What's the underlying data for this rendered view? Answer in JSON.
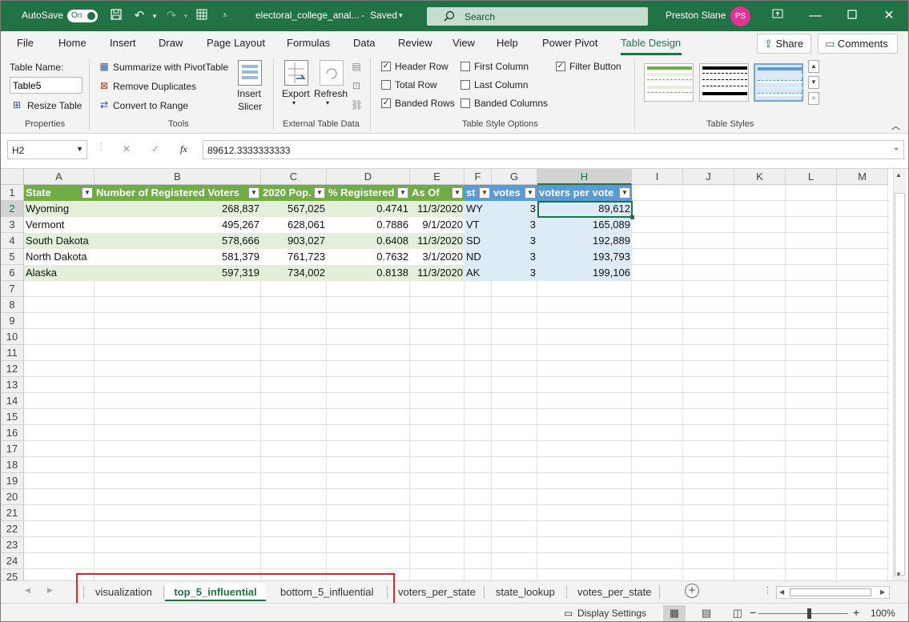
{
  "titlebar": {
    "autosave_label": "AutoSave",
    "autosave_state": "On",
    "filename": "electoral_college_anal...",
    "save_status": "Saved",
    "search_placeholder": "Search",
    "user_name": "Preston Slane",
    "user_initials": "PS"
  },
  "menu": {
    "items": [
      "File",
      "Home",
      "Insert",
      "Draw",
      "Page Layout",
      "Formulas",
      "Data",
      "Review",
      "View",
      "Help",
      "Power Pivot",
      "Table Design"
    ],
    "active": "Table Design",
    "share_label": "Share",
    "comments_label": "Comments"
  },
  "ribbon": {
    "properties": {
      "table_name_label": "Table Name:",
      "table_name_value": "Table5",
      "resize_label": "Resize Table",
      "group_label": "Properties"
    },
    "tools": {
      "summarize_label": "Summarize with PivotTable",
      "remove_dupes_label": "Remove Duplicates",
      "convert_label": "Convert to Range",
      "insert_slicer_line1": "Insert",
      "insert_slicer_line2": "Slicer",
      "group_label": "Tools"
    },
    "external": {
      "export_label": "Export",
      "refresh_label": "Refresh",
      "group_label": "External Table Data"
    },
    "style_options": {
      "header_row": {
        "label": "Header Row",
        "checked": true
      },
      "total_row": {
        "label": "Total Row",
        "checked": false
      },
      "banded_rows": {
        "label": "Banded Rows",
        "checked": true
      },
      "first_column": {
        "label": "First Column",
        "checked": false
      },
      "last_column": {
        "label": "Last Column",
        "checked": false
      },
      "banded_columns": {
        "label": "Banded Columns",
        "checked": false
      },
      "filter_button": {
        "label": "Filter Button",
        "checked": true
      },
      "group_label": "Table Style Options"
    },
    "styles": {
      "group_label": "Table Styles",
      "swatch_colors": [
        "#70ad47",
        "#000000",
        "#5b9bd5"
      ]
    }
  },
  "formula_bar": {
    "name_box": "H2",
    "cancel_icon": "✕",
    "enter_icon": "✓",
    "fx_label": "fx",
    "formula": "89612.3333333333"
  },
  "grid": {
    "columns": [
      "A",
      "B",
      "C",
      "D",
      "E",
      "F",
      "G",
      "H",
      "I",
      "J",
      "K",
      "L",
      "M"
    ],
    "selected_column": "H",
    "row_numbers": [
      "1",
      "2",
      "3",
      "4",
      "5",
      "6",
      "7",
      "8",
      "9",
      "10",
      "11",
      "12",
      "13",
      "14",
      "15",
      "16",
      "17",
      "18",
      "19",
      "20",
      "21",
      "22",
      "23",
      "24",
      "25"
    ],
    "selected_row": "2",
    "headers": [
      "State",
      "Number of Registered Voters",
      "2020 Pop.",
      "% Registered",
      "As Of",
      "st",
      "votes",
      "voters per vote"
    ],
    "rows": [
      [
        "Wyoming",
        "268,837",
        "567,025",
        "0.4741",
        "11/3/2020",
        "WY",
        "3",
        "89,612"
      ],
      [
        "Vermont",
        "495,267",
        "628,061",
        "0.7886",
        "9/1/2020",
        "VT",
        "3",
        "165,089"
      ],
      [
        "South Dakota",
        "578,666",
        "903,027",
        "0.6408",
        "11/3/2020",
        "SD",
        "3",
        "192,889"
      ],
      [
        "North Dakota",
        "581,379",
        "761,723",
        "0.7632",
        "3/1/2020",
        "ND",
        "3",
        "193,793"
      ],
      [
        "Alaska",
        "597,319",
        "734,002",
        "0.8138",
        "11/3/2020",
        "AK",
        "3",
        "199,106"
      ]
    ]
  },
  "sheet_tabs": {
    "tabs": [
      "visualization",
      "top_5_influential",
      "bottom_5_influential",
      "voters_per_state",
      "state_lookup",
      "votes_per_state"
    ],
    "active": "top_5_influential"
  },
  "statusbar": {
    "display_settings": "Display Settings",
    "zoom_level": "100%",
    "zoom_minus": "−",
    "zoom_plus": "+"
  },
  "colors": {
    "brand": "#217346",
    "table_header_green": "#70ad47",
    "table_header_blue": "#5b9bd5",
    "band_green": "#e2efda",
    "band_blue": "#ddebf7",
    "highlight_red": "#d9262c"
  }
}
